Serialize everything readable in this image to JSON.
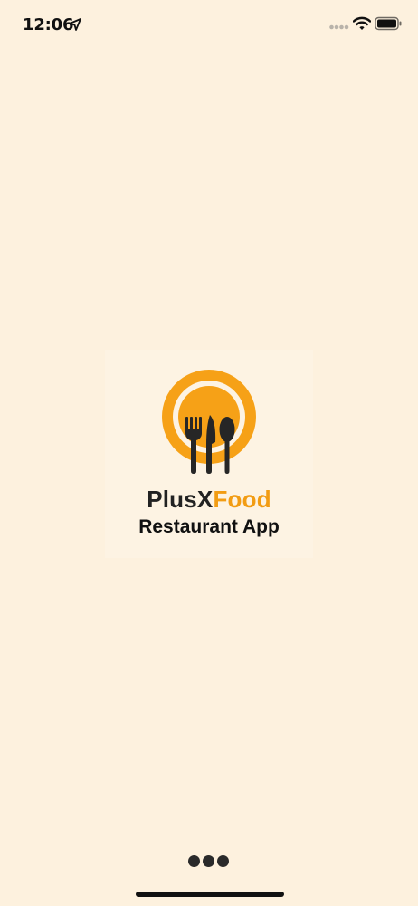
{
  "status_bar": {
    "time": "12:06",
    "icons": [
      "location-arrow-icon",
      "cellular-signal-icon",
      "wifi-icon",
      "battery-icon"
    ]
  },
  "logo": {
    "brand_part_a": "PlusX",
    "brand_part_b": "Food",
    "tagline": "Restaurant App",
    "icons": [
      "plate-icon",
      "fork-icon",
      "knife-icon",
      "spoon-icon"
    ]
  },
  "colors": {
    "background": "#fdf1de",
    "accent": "#f29c13",
    "dark": "#222222"
  },
  "loading": {
    "icon": "loading-dots-icon"
  }
}
